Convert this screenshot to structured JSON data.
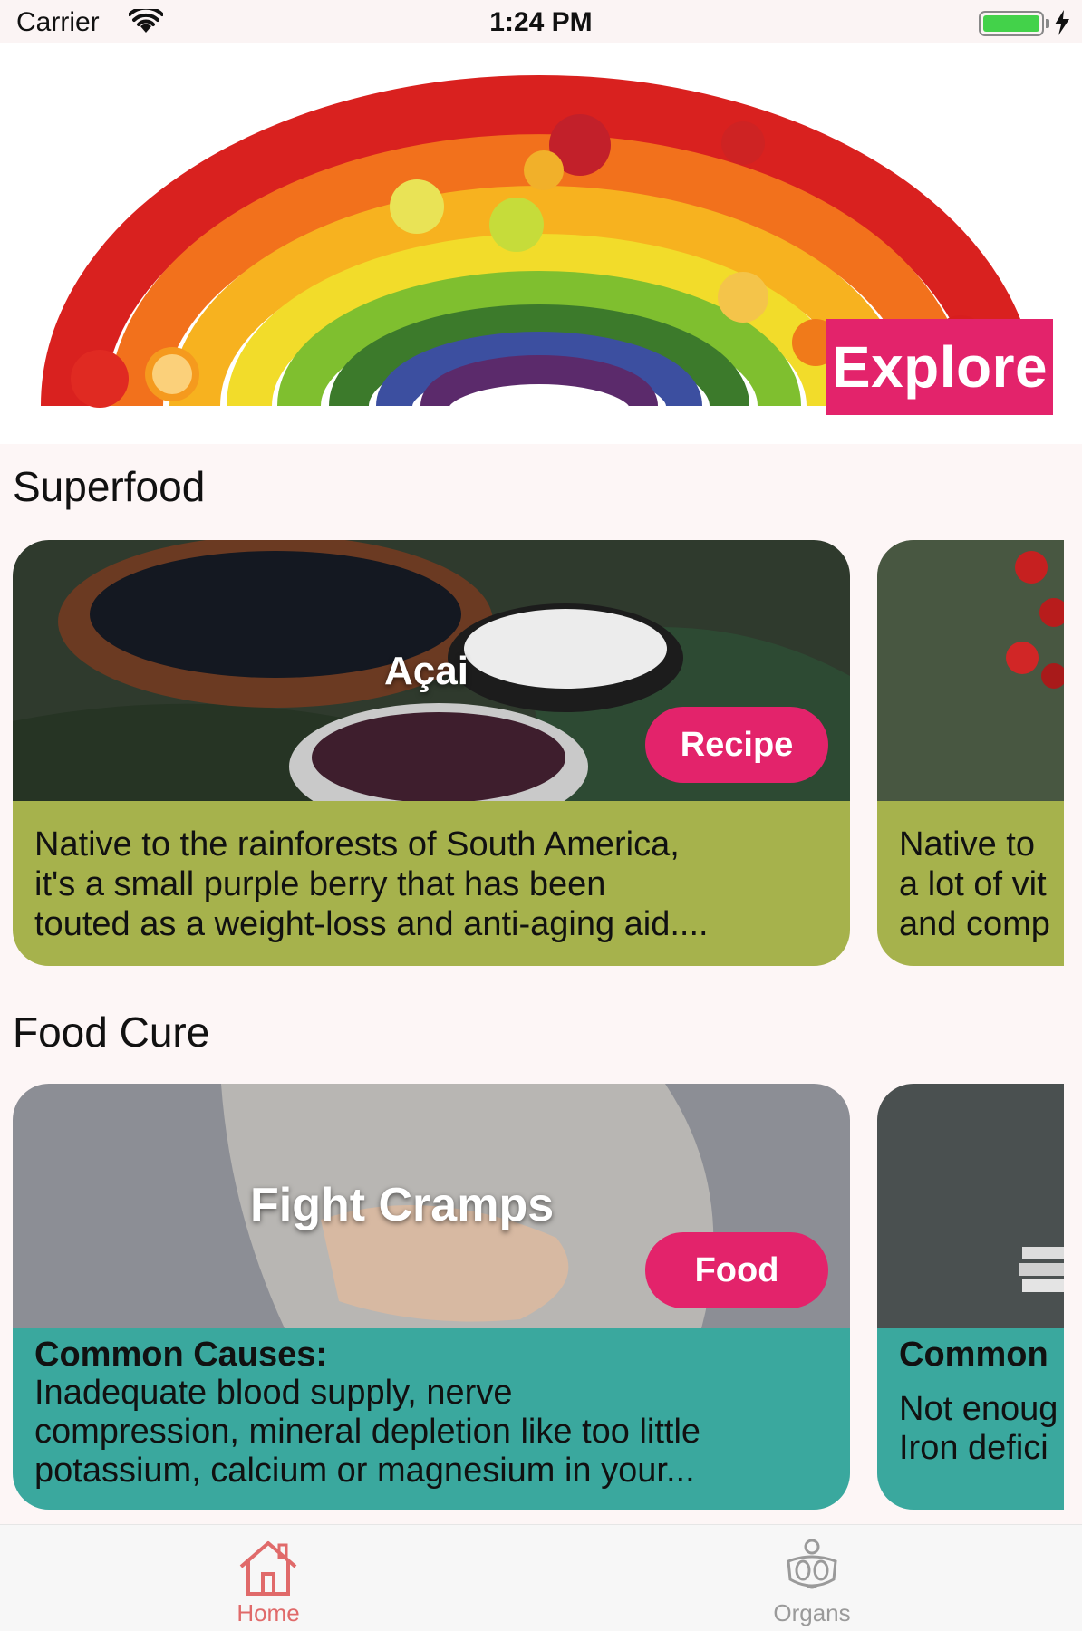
{
  "status_bar": {
    "carrier": "Carrier",
    "time": "1:24 PM"
  },
  "hero": {
    "explore_label": "Explore"
  },
  "superfood": {
    "section_title": "Superfood",
    "cards": [
      {
        "title": "Açai",
        "button": "Recipe",
        "lines": [
          "Native to the rainforests of South America,",
          "it's a small purple berry that has been",
          "touted as a weight-loss and anti-aging aid...."
        ]
      },
      {
        "title": "",
        "button": "",
        "lines": [
          "Native to",
          "a lot of vit",
          "and comp"
        ]
      }
    ]
  },
  "food_cure": {
    "section_title": "Food Cure",
    "cards": [
      {
        "title": "Fight Cramps",
        "button": "Food",
        "heading": "Common Causes:",
        "lines": [
          "Inadequate blood supply, nerve",
          "compression, mineral depletion like too little",
          "potassium, calcium or magnesium in your..."
        ]
      },
      {
        "title": "",
        "button": "",
        "heading": "Common",
        "lines": [
          "Not enoug",
          "Iron defici"
        ]
      }
    ]
  },
  "tab_bar": {
    "tabs": [
      {
        "label": "Home",
        "icon": "home-icon",
        "active": true
      },
      {
        "label": "Organs",
        "icon": "organs-icon",
        "active": false
      }
    ]
  },
  "colors": {
    "accent": "#e3236b",
    "superfood_body": "#a6b24c",
    "foodcure_body": "#3aa89e",
    "active_tab": "#e06a6a",
    "inactive_tab": "#9a9a9a"
  }
}
